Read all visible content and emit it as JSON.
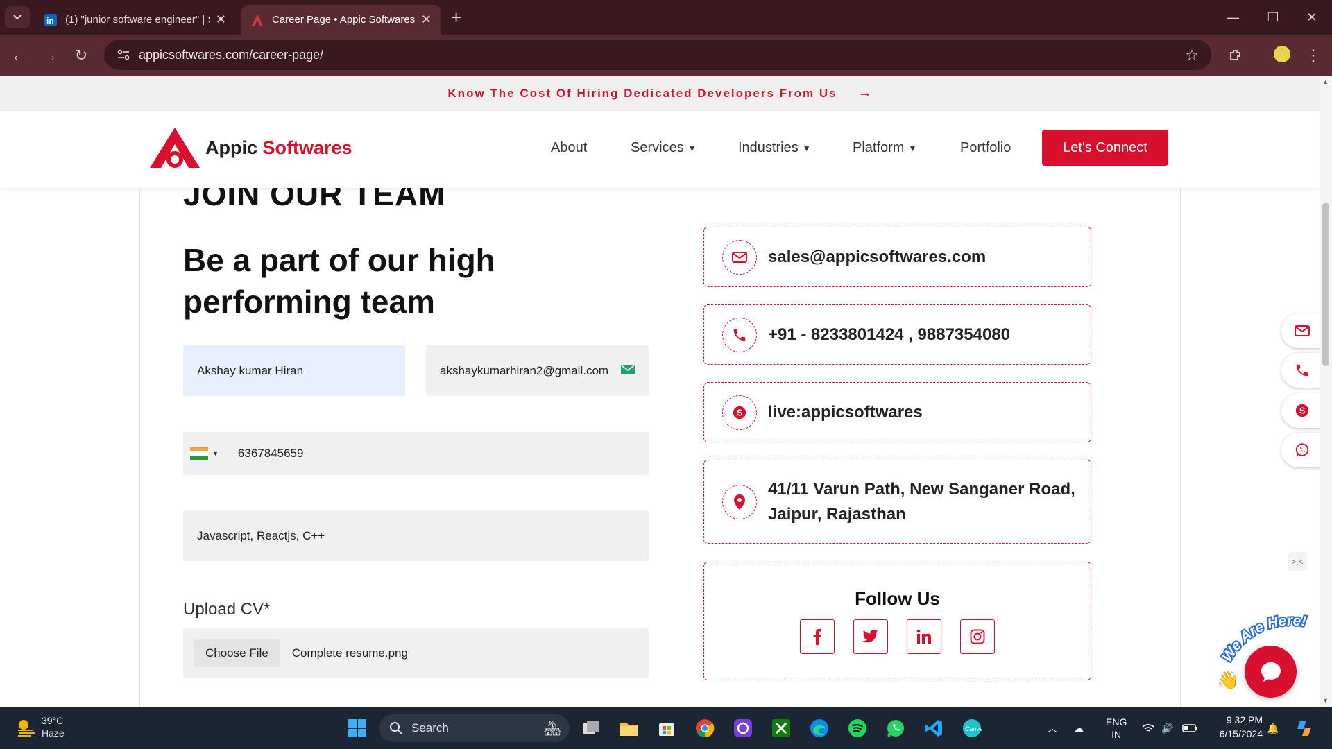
{
  "browser": {
    "tabs": [
      {
        "title": "(1) \"junior software engineer\" | S",
        "favicon": "linkedin-icon"
      },
      {
        "title": "Career Page • Appic Softwares",
        "favicon": "appic-icon",
        "active": true
      }
    ],
    "url": "appicsoftwares.com/career-page/"
  },
  "promo": {
    "text": "Know The Cost Of Hiring Dedicated Developers From Us",
    "arrow": "→"
  },
  "header": {
    "logo_main": "Appic",
    "logo_accent": "Softwares",
    "nav": [
      "About",
      "Services",
      "Industries",
      "Platform",
      "Portfolio"
    ],
    "cta": "Let's Connect"
  },
  "hero": {
    "eyebrow": "JOIN OUR TEAM",
    "headline": "Be a part of our high performing team"
  },
  "form": {
    "name": "Akshay kumar Hiran",
    "email": "akshaykumarhiran2@gmail.com",
    "phone": "6367845659",
    "skills": "Javascript, Reactjs, C++",
    "upload_label": "Upload CV*",
    "choose_file": "Choose File",
    "file_name": "Complete resume.png"
  },
  "contact": {
    "email": "sales@appicsoftwares.com",
    "phone": "+91 - 8233801424 , 9887354080",
    "skype": "live:appicsoftwares",
    "address_line1": "41/11 Varun Path, New Sanganer Road,",
    "address_line2": "Jaipur, Rajasthan",
    "follow_title": "Follow Us"
  },
  "taskbar": {
    "temperature": "39°C",
    "weather": "Haze",
    "search": "Search",
    "lang1": "ENG",
    "lang2": "IN",
    "time": "9:32 PM",
    "date": "6/15/2024"
  },
  "colors": {
    "brand": "#d8102e",
    "chrome": "#5a2a33",
    "taskbar": "#1c2533"
  }
}
